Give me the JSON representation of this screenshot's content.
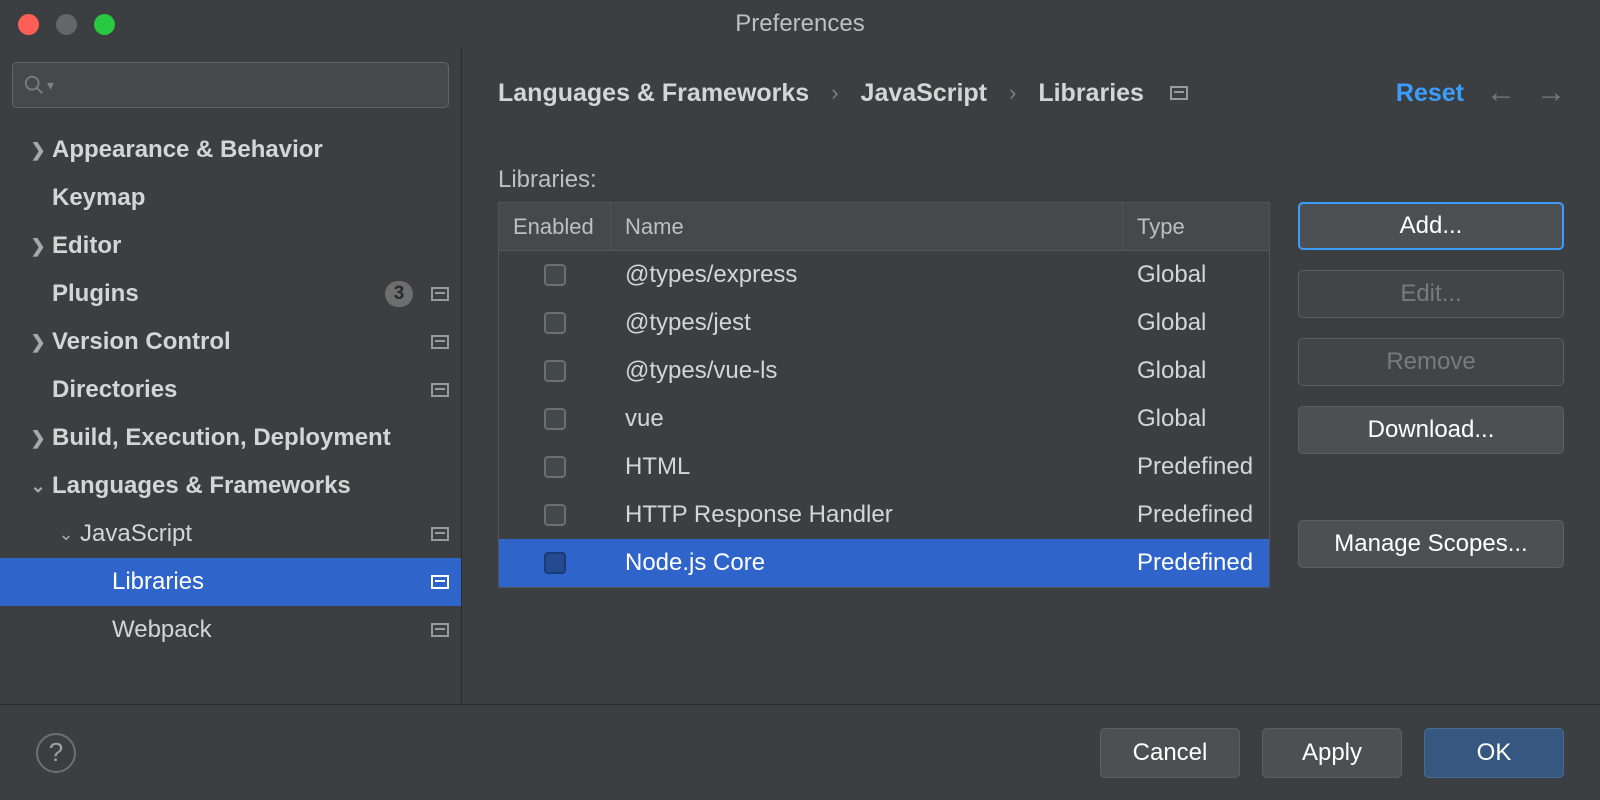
{
  "window": {
    "title": "Preferences"
  },
  "sidebar": {
    "items": [
      {
        "label": "Appearance & Behavior"
      },
      {
        "label": "Keymap"
      },
      {
        "label": "Editor"
      },
      {
        "label": "Plugins",
        "badge": "3"
      },
      {
        "label": "Version Control"
      },
      {
        "label": "Directories"
      },
      {
        "label": "Build, Execution, Deployment"
      },
      {
        "label": "Languages & Frameworks"
      },
      {
        "label": "JavaScript"
      },
      {
        "label": "Libraries"
      },
      {
        "label": "Webpack"
      }
    ]
  },
  "breadcrumb": {
    "a": "Languages & Frameworks",
    "b": "JavaScript",
    "c": "Libraries",
    "reset": "Reset"
  },
  "libraries": {
    "heading": "Libraries:",
    "columns": {
      "enabled": "Enabled",
      "name": "Name",
      "type": "Type"
    },
    "rows": [
      {
        "name": "@types/express",
        "type": "Global"
      },
      {
        "name": "@types/jest",
        "type": "Global"
      },
      {
        "name": "@types/vue-ls",
        "type": "Global"
      },
      {
        "name": "vue",
        "type": "Global"
      },
      {
        "name": "HTML",
        "type": "Predefined"
      },
      {
        "name": "HTTP Response Handler",
        "type": "Predefined"
      },
      {
        "name": "Node.js Core",
        "type": "Predefined"
      }
    ]
  },
  "buttons": {
    "add": "Add...",
    "edit": "Edit...",
    "remove": "Remove",
    "download": "Download...",
    "manage_scopes": "Manage Scopes..."
  },
  "footer": {
    "cancel": "Cancel",
    "apply": "Apply",
    "ok": "OK"
  }
}
